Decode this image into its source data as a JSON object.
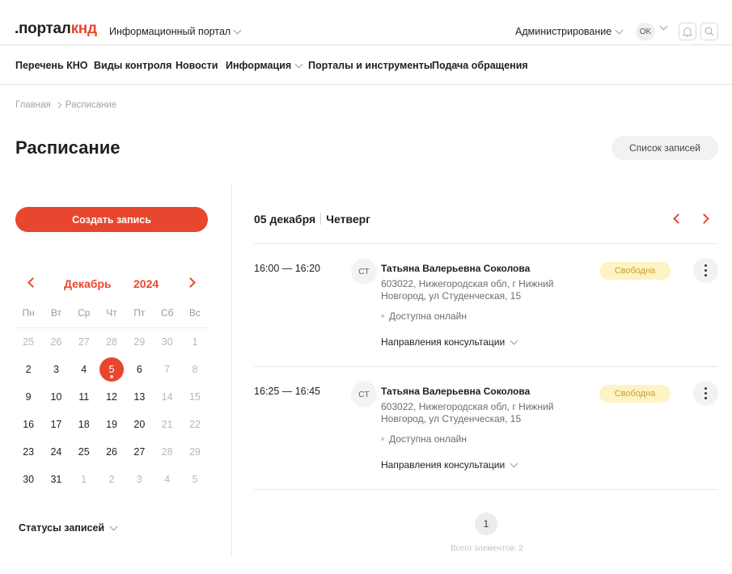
{
  "header": {
    "logo_prefix": ".портал",
    "logo_accent": "кнд",
    "portal_switch": "Информационный портал",
    "admin_menu": "Администрирование",
    "avatar_initials": "OK"
  },
  "nav": {
    "items": [
      "Перечень КНО",
      "Виды контроля",
      "Новости",
      "Информация",
      "Порталы и инструменты",
      "Подача обращения"
    ]
  },
  "breadcrumb": {
    "home": "Главная",
    "current": "Расписание"
  },
  "page": {
    "title": "Расписание",
    "list_button": "Список записей"
  },
  "sidebar": {
    "create_button": "Создать запись",
    "calendar": {
      "month": "Декабрь",
      "year": "2024",
      "weekdays": [
        "Пн",
        "Вт",
        "Ср",
        "Чт",
        "Пт",
        "Сб",
        "Вс"
      ],
      "weeks": [
        [
          "25",
          "26",
          "27",
          "28",
          "29",
          "30",
          "1"
        ],
        [
          "2",
          "3",
          "4",
          "5",
          "6",
          "7",
          "8"
        ],
        [
          "9",
          "10",
          "11",
          "12",
          "13",
          "14",
          "15"
        ],
        [
          "16",
          "17",
          "18",
          "19",
          "20",
          "21",
          "22"
        ],
        [
          "23",
          "24",
          "25",
          "26",
          "27",
          "28",
          "29"
        ],
        [
          "30",
          "31",
          "1",
          "2",
          "3",
          "4",
          "5"
        ]
      ],
      "selected_day": "5"
    },
    "statuses_label": "Статусы записей"
  },
  "schedule": {
    "date": "05 декабря",
    "weekday": "Четверг",
    "slots": [
      {
        "time": "16:00 — 16:20",
        "initials": "СТ",
        "name": "Татьяна Валерьевна Соколова",
        "address": "603022, Нижегородская обл, г Нижний Новгород, ул Студенческая, 15",
        "online": "Доступна онлайн",
        "directions": "Направления консультации",
        "status": "Свободна"
      },
      {
        "time": "16:25 — 16:45",
        "initials": "СТ",
        "name": "Татьяна Валерьевна Соколова",
        "address": "603022, Нижегородская обл, г Нижний Новгород, ул Студенческая, 15",
        "online": "Доступна онлайн",
        "directions": "Направления консультации",
        "status": "Свободна"
      }
    ],
    "pagination": {
      "current_page": "1",
      "total_text": "Всего элементов: 2"
    }
  },
  "colors": {
    "accent": "#e8472f",
    "badge_bg": "#fdf3c4",
    "badge_text": "#c9a128"
  }
}
